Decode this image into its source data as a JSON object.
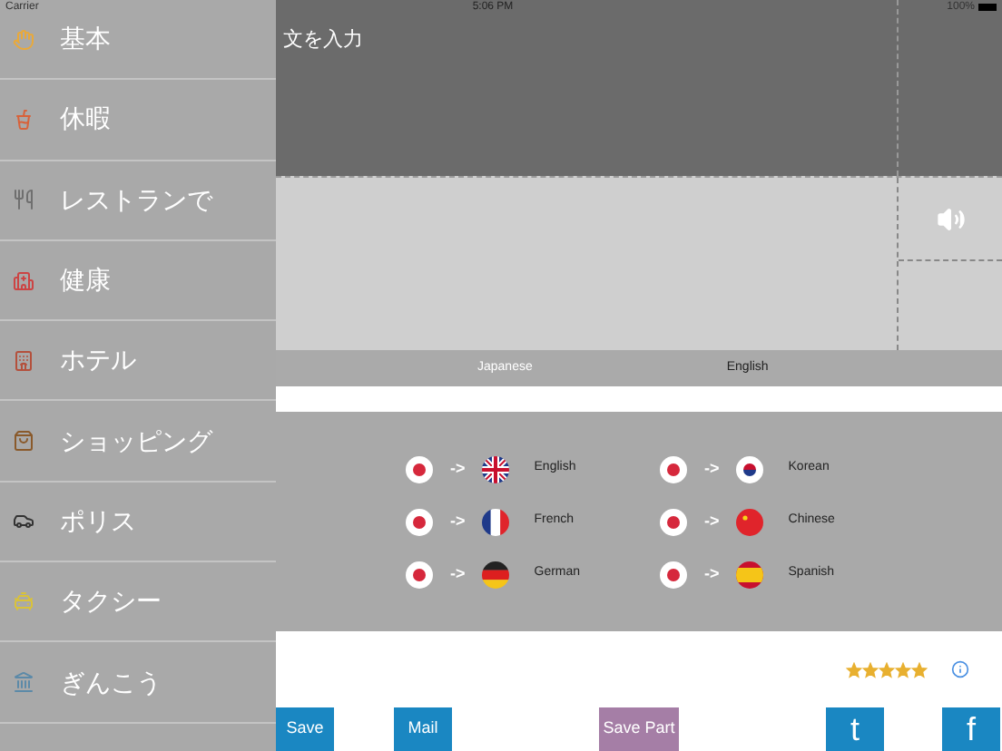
{
  "status_bar": {
    "carrier": "Carrier",
    "time": "5:06 PM",
    "battery": "100%"
  },
  "sidebar": {
    "items": [
      {
        "label": "基本",
        "selected": false
      },
      {
        "label": "休暇",
        "selected": false
      },
      {
        "label": "レストランで",
        "selected": false
      },
      {
        "label": "健康",
        "selected": false
      },
      {
        "label": "ホテル",
        "selected": false
      },
      {
        "label": "ショッピング",
        "selected": false
      },
      {
        "label": "ポリス",
        "selected": false
      },
      {
        "label": "タクシー",
        "selected": false
      },
      {
        "label": "ぎんこう",
        "selected": false
      }
    ]
  },
  "input": {
    "placeholder": "文を入力"
  },
  "language_bar": {
    "source": "Japanese",
    "target": "English"
  },
  "language_pairs": [
    {
      "arrow": "->",
      "label": "English"
    },
    {
      "arrow": "->",
      "label": "Korean"
    },
    {
      "arrow": "->",
      "label": "French"
    },
    {
      "arrow": "->",
      "label": "Chinese"
    },
    {
      "arrow": "->",
      "label": "German"
    },
    {
      "arrow": "->",
      "label": "Spanish"
    }
  ],
  "rating": {
    "stars": 5
  },
  "buttons": [
    {
      "label": "Save",
      "kind": "text"
    },
    {
      "label": "Mail",
      "kind": "text"
    },
    {
      "label": "Save Part",
      "kind": "accent"
    },
    {
      "label": "t",
      "kind": "social"
    },
    {
      "label": "f",
      "kind": "social"
    }
  ]
}
